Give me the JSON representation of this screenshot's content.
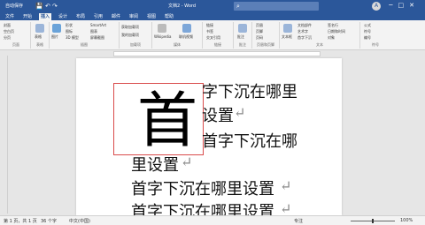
{
  "titlebar": {
    "autosave": "自动保存",
    "doc_title": "文档2 - Word",
    "search_icon": "search-icon",
    "user_initial": ""
  },
  "tabs": [
    "文件",
    "开始",
    "插入",
    "设计",
    "布局",
    "引用",
    "邮件",
    "审阅",
    "视图",
    "帮助"
  ],
  "active_tab": "插入",
  "ribbon": {
    "pages": {
      "items": [
        "封面",
        "空白页",
        "分页"
      ],
      "label": "页面"
    },
    "table": {
      "item": "表格",
      "label": "表格"
    },
    "illustrations": {
      "items": [
        "图片",
        "形状",
        "图标",
        "3D 模型",
        "SmartArt",
        "图表",
        "屏幕截图"
      ],
      "label": "插图"
    },
    "addins": {
      "items": [
        "获取加载项",
        "我的加载项"
      ],
      "label": "加载项"
    },
    "media": {
      "items": [
        "Wikipedia",
        "联机视频"
      ],
      "label": "媒体"
    },
    "links": {
      "items": [
        "链接",
        "书签",
        "交叉引用"
      ],
      "label": "链接"
    },
    "comments": {
      "item": "批注",
      "label": "批注"
    },
    "headerfooter": {
      "items": [
        "页眉",
        "页脚",
        "页码"
      ],
      "label": "页眉和页脚"
    },
    "text": {
      "items": [
        "文本框",
        "文档部件",
        "艺术字",
        "首字下沉",
        "签名行",
        "日期和时间",
        "对象"
      ],
      "label": "文本"
    },
    "symbols": {
      "items": [
        "公式",
        "符号",
        "编号"
      ],
      "label": "符号"
    }
  },
  "document": {
    "drop_cap": "首",
    "lines": [
      "字下沉在哪里",
      "设置",
      "首字下沉在哪",
      "里设置",
      "首字下沉在哪里设置",
      "首字下沉在哪里设置"
    ],
    "paragraph_mark": "↵"
  },
  "status": {
    "page": "第 1 页，共 1 页",
    "words": "36 个字",
    "language": "中文(中国)",
    "focus": "专注",
    "zoom": "100%"
  }
}
